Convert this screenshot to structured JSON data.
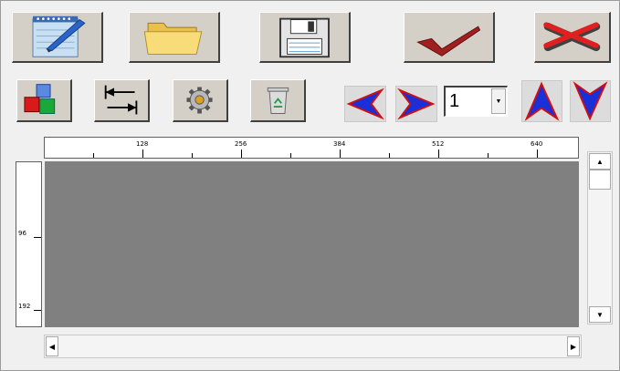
{
  "toolbar": {
    "value_select": {
      "selected": "1"
    }
  },
  "ruler": {
    "horizontal_labels": [
      "128",
      "256",
      "384",
      "512",
      "640"
    ],
    "vertical_labels": [
      "96",
      "192"
    ]
  },
  "colors": {
    "canvas": "#808080",
    "button_face": "#d4d0c8",
    "arrow_fill": "#1a2fd8",
    "arrow_outline": "#d01010"
  },
  "icons": {
    "new": "notepad-pen-icon",
    "open": "folder-icon",
    "save": "floppy-disk-icon",
    "confirm": "checkmark-icon",
    "cancel": "red-x-icon",
    "components": "cubes-icon",
    "fit_width": "fit-width-arrows-icon",
    "settings": "gear-icon",
    "delete": "recycle-bin-icon",
    "prev": "left-arrow-icon",
    "next": "right-arrow-icon",
    "up": "up-arrow-icon",
    "down": "down-arrow-icon"
  }
}
